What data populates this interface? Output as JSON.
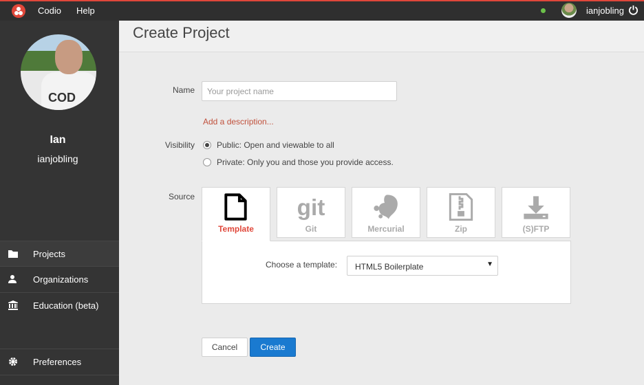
{
  "topbar": {
    "brand": "Codio",
    "help": "Help",
    "username": "ianjobling"
  },
  "sidebar": {
    "user_name": "Ian",
    "user_handle": "ianjobling",
    "avatar_shirt_text": "COD",
    "items": [
      {
        "label": "Projects",
        "icon": "folder-icon"
      },
      {
        "label": "Organizations",
        "icon": "users-icon"
      },
      {
        "label": "Education (beta)",
        "icon": "institution-icon"
      },
      {
        "label": "Preferences",
        "icon": "gear-icon"
      }
    ]
  },
  "main": {
    "title": "Create Project",
    "name_label": "Name",
    "name_placeholder": "Your project name",
    "description_link": "Add a description...",
    "visibility_label": "Visibility",
    "visibility_options": [
      {
        "label": "Public: Open and viewable to all",
        "selected": true
      },
      {
        "label": "Private: Only you and those you provide access.",
        "selected": false
      }
    ],
    "source_label": "Source",
    "source_tabs": [
      {
        "label": "Template",
        "icon": "document-icon",
        "active": true
      },
      {
        "label": "Git",
        "icon": "git-icon",
        "active": false
      },
      {
        "label": "Mercurial",
        "icon": "mercurial-icon",
        "active": false
      },
      {
        "label": "Zip",
        "icon": "zip-icon",
        "active": false
      },
      {
        "label": "(S)FTP",
        "icon": "download-icon",
        "active": false
      }
    ],
    "template_label": "Choose a template:",
    "template_value": "HTML5 Boilerplate",
    "cancel_label": "Cancel",
    "create_label": "Create"
  },
  "colors": {
    "accent": "#e0473a",
    "primary_button": "#1a7ad0",
    "sidebar": "#343434",
    "topbar": "#2f2f2f"
  }
}
